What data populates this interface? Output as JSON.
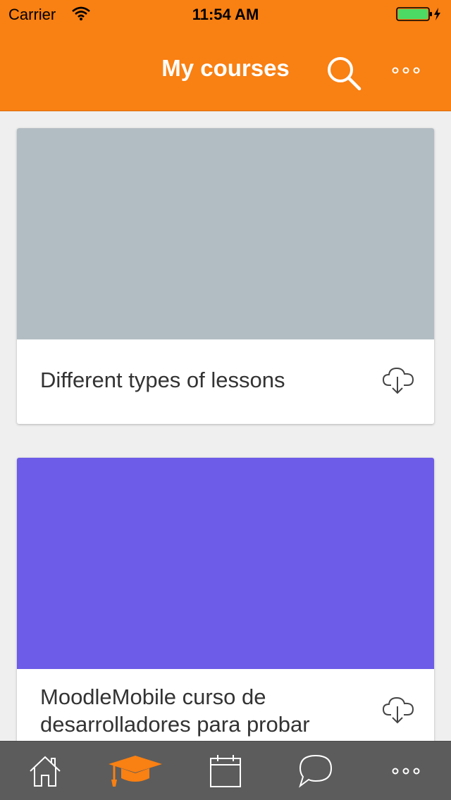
{
  "status_bar": {
    "carrier": "Carrier",
    "time": "11:54 AM",
    "battery_color": "#4cd964"
  },
  "header": {
    "title": "My courses",
    "background": "#f98012",
    "search_icon": "search-icon",
    "more_icon": "more-horizontal-icon"
  },
  "courses": [
    {
      "title": "Different types of lessons",
      "image_color": "#b2bcc3",
      "action_icon": "cloud-download-icon"
    },
    {
      "title": "MoodleMobile curso de desarrolladores para probar",
      "image_color": "#6c5ce7",
      "action_icon": "cloud-download-icon"
    }
  ],
  "tabbar": {
    "background": "#5c5c5c",
    "active_color": "#f98012",
    "items": [
      {
        "icon": "home-icon",
        "active": false
      },
      {
        "icon": "graduation-cap-icon",
        "active": true
      },
      {
        "icon": "calendar-icon",
        "active": false
      },
      {
        "icon": "chat-bubble-icon",
        "active": false
      },
      {
        "icon": "more-horizontal-icon",
        "active": false
      }
    ]
  }
}
